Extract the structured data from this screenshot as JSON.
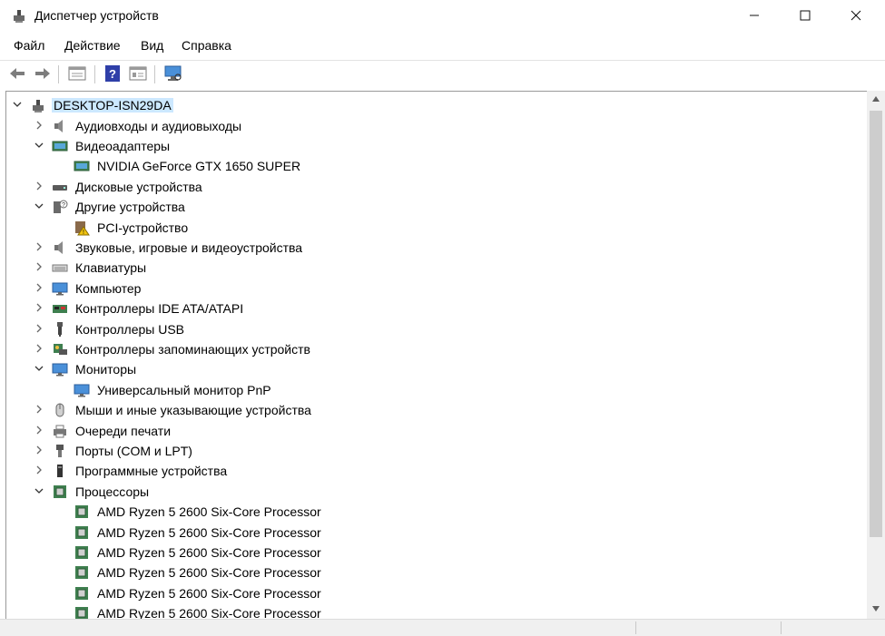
{
  "window": {
    "title": "Диспетчер устройств",
    "accent": "#cce8ff"
  },
  "menu": [
    {
      "label": "Файл"
    },
    {
      "label": "Действие"
    },
    {
      "label": "Вид"
    },
    {
      "label": "Справка"
    }
  ],
  "toolbar": [
    {
      "name": "back-arrow-icon"
    },
    {
      "name": "forward-arrow-icon"
    },
    {
      "name": "properties-icon"
    },
    {
      "name": "help-icon"
    },
    {
      "name": "details-view-icon"
    },
    {
      "name": "monitor-scan-icon"
    }
  ],
  "tree": {
    "root": {
      "label": "DESKTOP-ISN29DA",
      "icon": "computer-icon",
      "expanded": true
    },
    "items": [
      {
        "label": "Аудиовходы и аудиовыходы",
        "icon": "speaker-icon",
        "level": 1,
        "expander": "collapsed"
      },
      {
        "label": "Видеоадаптеры",
        "icon": "display-adapter-icon",
        "level": 1,
        "expander": "expanded"
      },
      {
        "label": "NVIDIA GeForce GTX 1650 SUPER",
        "icon": "display-adapter-icon",
        "level": 2,
        "expander": "none"
      },
      {
        "label": "Дисковые устройства",
        "icon": "disk-drive-icon",
        "level": 1,
        "expander": "collapsed"
      },
      {
        "label": "Другие устройства",
        "icon": "unknown-device-icon",
        "level": 1,
        "expander": "expanded"
      },
      {
        "label": "PCI-устройство",
        "icon": "warning-device-icon",
        "level": 2,
        "expander": "none"
      },
      {
        "label": "Звуковые, игровые и видеоустройства",
        "icon": "speaker-icon",
        "level": 1,
        "expander": "collapsed"
      },
      {
        "label": "Клавиатуры",
        "icon": "keyboard-icon",
        "level": 1,
        "expander": "collapsed"
      },
      {
        "label": "Компьютер",
        "icon": "monitor-icon",
        "level": 1,
        "expander": "collapsed"
      },
      {
        "label": "Контроллеры IDE ATA/ATAPI",
        "icon": "ide-controller-icon",
        "level": 1,
        "expander": "collapsed"
      },
      {
        "label": "Контроллеры USB",
        "icon": "usb-icon",
        "level": 1,
        "expander": "collapsed"
      },
      {
        "label": "Контроллеры запоминающих устройств",
        "icon": "storage-controller-icon",
        "level": 1,
        "expander": "collapsed"
      },
      {
        "label": "Мониторы",
        "icon": "monitor-icon",
        "level": 1,
        "expander": "expanded"
      },
      {
        "label": "Универсальный монитор PnP",
        "icon": "monitor-icon",
        "level": 2,
        "expander": "none"
      },
      {
        "label": "Мыши и иные указывающие устройства",
        "icon": "mouse-icon",
        "level": 1,
        "expander": "collapsed"
      },
      {
        "label": "Очереди печати",
        "icon": "printer-icon",
        "level": 1,
        "expander": "collapsed"
      },
      {
        "label": "Порты (COM и LPT)",
        "icon": "port-icon",
        "level": 1,
        "expander": "collapsed"
      },
      {
        "label": "Программные устройства",
        "icon": "software-device-icon",
        "level": 1,
        "expander": "collapsed"
      },
      {
        "label": "Процессоры",
        "icon": "processor-icon",
        "level": 1,
        "expander": "expanded"
      },
      {
        "label": "AMD Ryzen 5 2600 Six-Core Processor",
        "icon": "processor-icon",
        "level": 2,
        "expander": "none"
      },
      {
        "label": "AMD Ryzen 5 2600 Six-Core Processor",
        "icon": "processor-icon",
        "level": 2,
        "expander": "none"
      },
      {
        "label": "AMD Ryzen 5 2600 Six-Core Processor",
        "icon": "processor-icon",
        "level": 2,
        "expander": "none"
      },
      {
        "label": "AMD Ryzen 5 2600 Six-Core Processor",
        "icon": "processor-icon",
        "level": 2,
        "expander": "none"
      },
      {
        "label": "AMD Ryzen 5 2600 Six-Core Processor",
        "icon": "processor-icon",
        "level": 2,
        "expander": "none"
      },
      {
        "label": "AMD Ryzen 5 2600 Six-Core Processor",
        "icon": "processor-icon",
        "level": 2,
        "expander": "none"
      }
    ]
  }
}
